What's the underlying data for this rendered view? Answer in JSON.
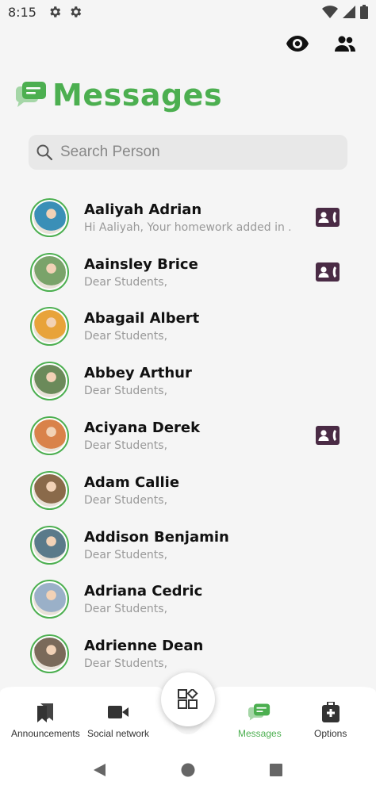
{
  "status_bar": {
    "time": "8:15"
  },
  "header": {
    "title": "Messages"
  },
  "search": {
    "placeholder": "Search Person"
  },
  "contacts": [
    {
      "name": "Aaliyah Adrian",
      "preview": "Hi Aaliyah, Your homework added in ...",
      "has_card": true,
      "avatar_color": "#3a8fb7"
    },
    {
      "name": "Aainsley Brice",
      "preview": "Dear Students,",
      "has_card": true,
      "avatar_color": "#7aa36a"
    },
    {
      "name": "Abagail Albert",
      "preview": "Dear Students,",
      "has_card": false,
      "avatar_color": "#e8a33a"
    },
    {
      "name": "Abbey Arthur",
      "preview": "Dear Students,",
      "has_card": false,
      "avatar_color": "#6b8a5a"
    },
    {
      "name": "Aciyana Derek",
      "preview": "Dear Students,",
      "has_card": true,
      "avatar_color": "#d9824a"
    },
    {
      "name": "Adam Callie",
      "preview": "Dear Students,",
      "has_card": false,
      "avatar_color": "#8a6a4a"
    },
    {
      "name": "Addison Benjamin",
      "preview": "Dear Students,",
      "has_card": false,
      "avatar_color": "#5a7a8a"
    },
    {
      "name": "Adriana Cedric",
      "preview": "Dear Students,",
      "has_card": false,
      "avatar_color": "#9ab0c8"
    },
    {
      "name": "Adrienne Dean",
      "preview": "Dear Students,",
      "has_card": false,
      "avatar_color": "#7a6a5a"
    }
  ],
  "bottom_nav": {
    "items": [
      {
        "label": "Announcements",
        "icon": "bookmark-icon"
      },
      {
        "label": "Social network",
        "icon": "video-camera-icon"
      },
      {
        "label": "Messages",
        "icon": "chat-bubbles-icon"
      },
      {
        "label": "Options",
        "icon": "medical-bag-icon"
      }
    ],
    "center_icon": "apps-grid-icon",
    "active": "Messages"
  },
  "colors": {
    "accent": "#4caf50",
    "card_icon": "#4a2b45",
    "background": "#f5f5f5"
  }
}
